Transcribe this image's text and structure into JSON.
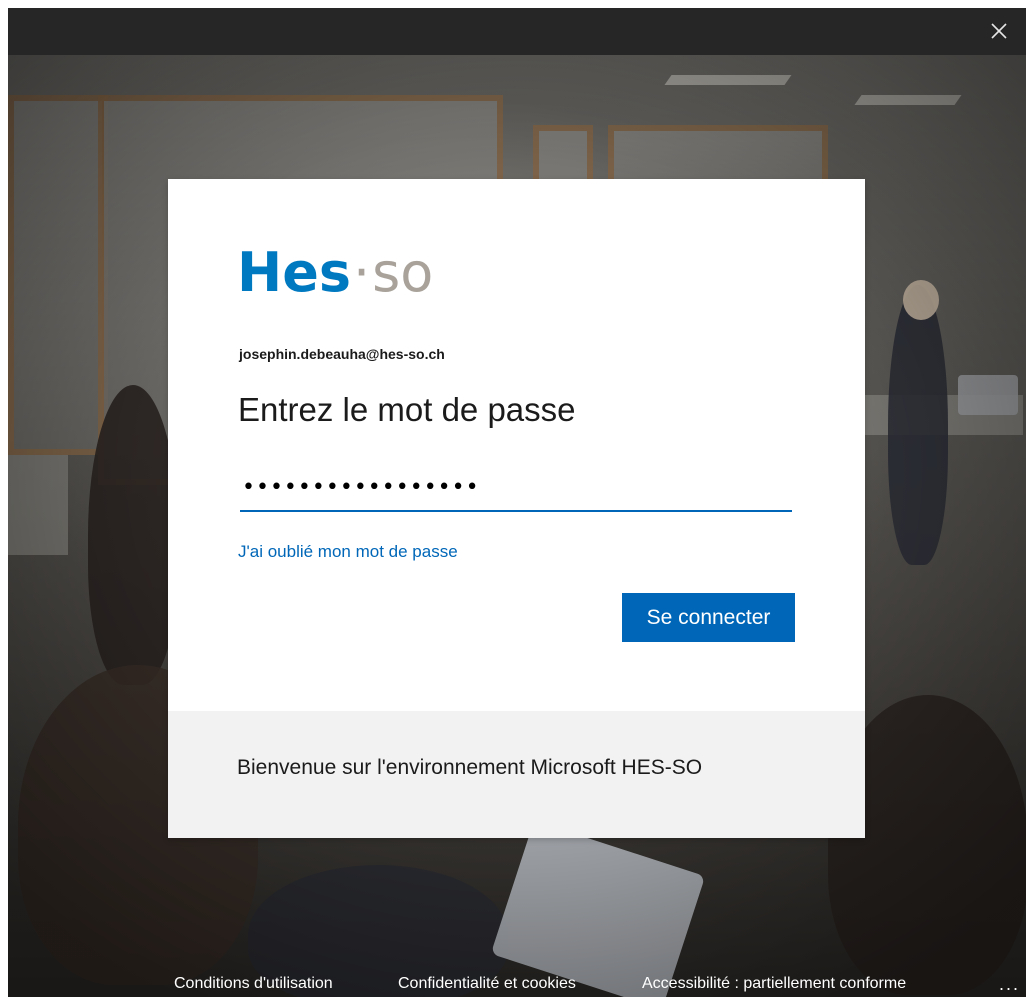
{
  "window": {
    "close_icon": "close-icon"
  },
  "card": {
    "logo_primary": "Hes",
    "logo_separator": "·",
    "logo_secondary": "so",
    "identity": "josephin.debeauha@hes-so.ch",
    "heading": "Entrez le mot de passe",
    "password_value": "•••••••••••••••••",
    "forgot_link": "J'ai oublié mon mot de passe",
    "submit_label": "Se connecter",
    "banner_text": "Bienvenue sur l'environnement Microsoft HES-SO"
  },
  "footer": {
    "links": [
      "Conditions d'utilisation",
      "Confidentialité et cookies",
      "Accessibilité : partiellement conforme"
    ],
    "more": "..."
  },
  "colors": {
    "accent": "#0067b8",
    "logo_blue": "#0079c1",
    "logo_grey": "#a8a29a",
    "banner_bg": "#f2f2f2",
    "titlebar_bg": "#262626"
  }
}
